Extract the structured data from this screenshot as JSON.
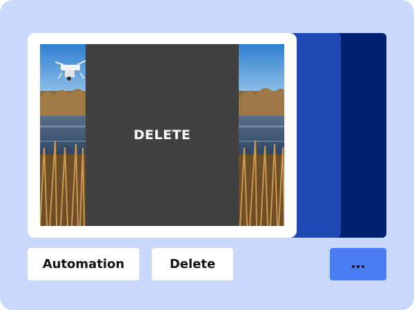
{
  "overlay": {
    "label": "DELETE"
  },
  "actions": {
    "automation_label": "Automation",
    "delete_label": "Delete",
    "more_icon": "more-horizontal-icon"
  },
  "colors": {
    "panel_bg": "#c9d8fd",
    "stack_mid": "#1f49b3",
    "stack_back": "#002070",
    "overlay_bg": "#414141",
    "more_button_bg": "#4a7cf2"
  }
}
